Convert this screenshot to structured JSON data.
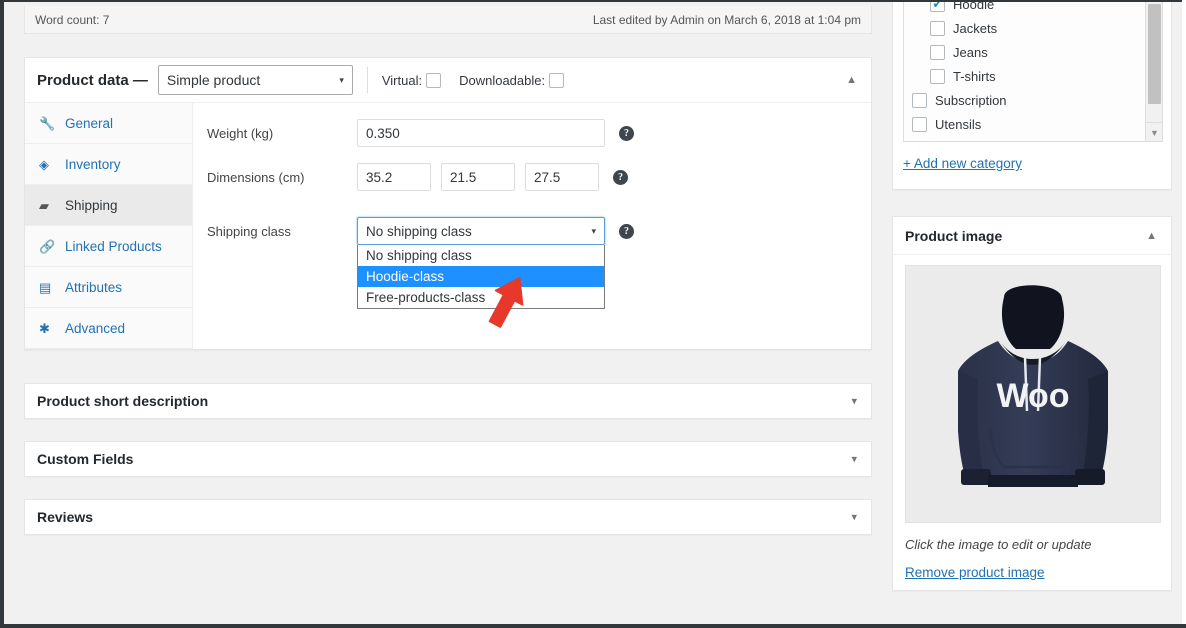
{
  "editor_footer": {
    "word_count_label": "Word count: 7",
    "last_edited": "Last edited by Admin on March 6, 2018 at 1:04 pm"
  },
  "product_data": {
    "title": "Product data —",
    "product_type": "Simple product",
    "caret_icon": "▾",
    "collapse_icon": "▲",
    "virtual": {
      "label": "Virtual:",
      "checked": false
    },
    "downloadable": {
      "label": "Downloadable:",
      "checked": false
    },
    "tabs": [
      {
        "label": "General",
        "icon": "🔧",
        "icon_name": "wrench-icon",
        "active": false
      },
      {
        "label": "Inventory",
        "icon": "◈",
        "icon_name": "box-icon",
        "active": false
      },
      {
        "label": "Shipping",
        "icon": "▰",
        "icon_name": "truck-icon",
        "active": true
      },
      {
        "label": "Linked Products",
        "icon": "🔗",
        "icon_name": "link-icon",
        "active": false
      },
      {
        "label": "Attributes",
        "icon": "▤",
        "icon_name": "list-icon",
        "active": false
      },
      {
        "label": "Advanced",
        "icon": "✱",
        "icon_name": "gear-icon",
        "active": false
      }
    ],
    "fields": {
      "weight": {
        "label": "Weight (kg)",
        "value": "0.350"
      },
      "dimensions": {
        "label": "Dimensions (cm)",
        "length": "35.2",
        "width": "21.5",
        "height": "27.5"
      },
      "shipping_class": {
        "label": "Shipping class",
        "value": "No shipping class",
        "open": true,
        "options": [
          {
            "label": "No shipping class",
            "selected": false
          },
          {
            "label": "Hoodie-class",
            "selected": true
          },
          {
            "label": "Free-products-class",
            "selected": false
          }
        ]
      }
    },
    "help_icon": "?"
  },
  "meta_boxes": [
    {
      "title": "Product short description",
      "toggle_icon": "▾"
    },
    {
      "title": "Custom Fields",
      "toggle_icon": "▾"
    },
    {
      "title": "Reviews",
      "toggle_icon": "▾"
    }
  ],
  "sidebar": {
    "categories": {
      "items": [
        {
          "label": "Hoodie",
          "checked": true,
          "child": true
        },
        {
          "label": "Jackets",
          "checked": false,
          "child": true
        },
        {
          "label": "Jeans",
          "checked": false,
          "child": true
        },
        {
          "label": "T-shirts",
          "checked": false,
          "child": true
        },
        {
          "label": "Subscription",
          "checked": false,
          "child": false
        },
        {
          "label": "Utensils",
          "checked": false,
          "child": false
        }
      ],
      "add_new_label": "+ Add new category",
      "scroll_arrow_icon": "▼"
    },
    "product_image": {
      "title": "Product image",
      "collapse_icon": "▲",
      "caption": "Click the image to edit or update",
      "remove_label": "Remove product image",
      "alt": "Navy hoodie with Woo logo",
      "logo_text": "Woo"
    }
  },
  "colors": {
    "accent_blue": "#2271b1",
    "option_highlight": "#1e90ff",
    "cursor_red": "#e8382a",
    "page_bg": "#f1f1f1"
  }
}
